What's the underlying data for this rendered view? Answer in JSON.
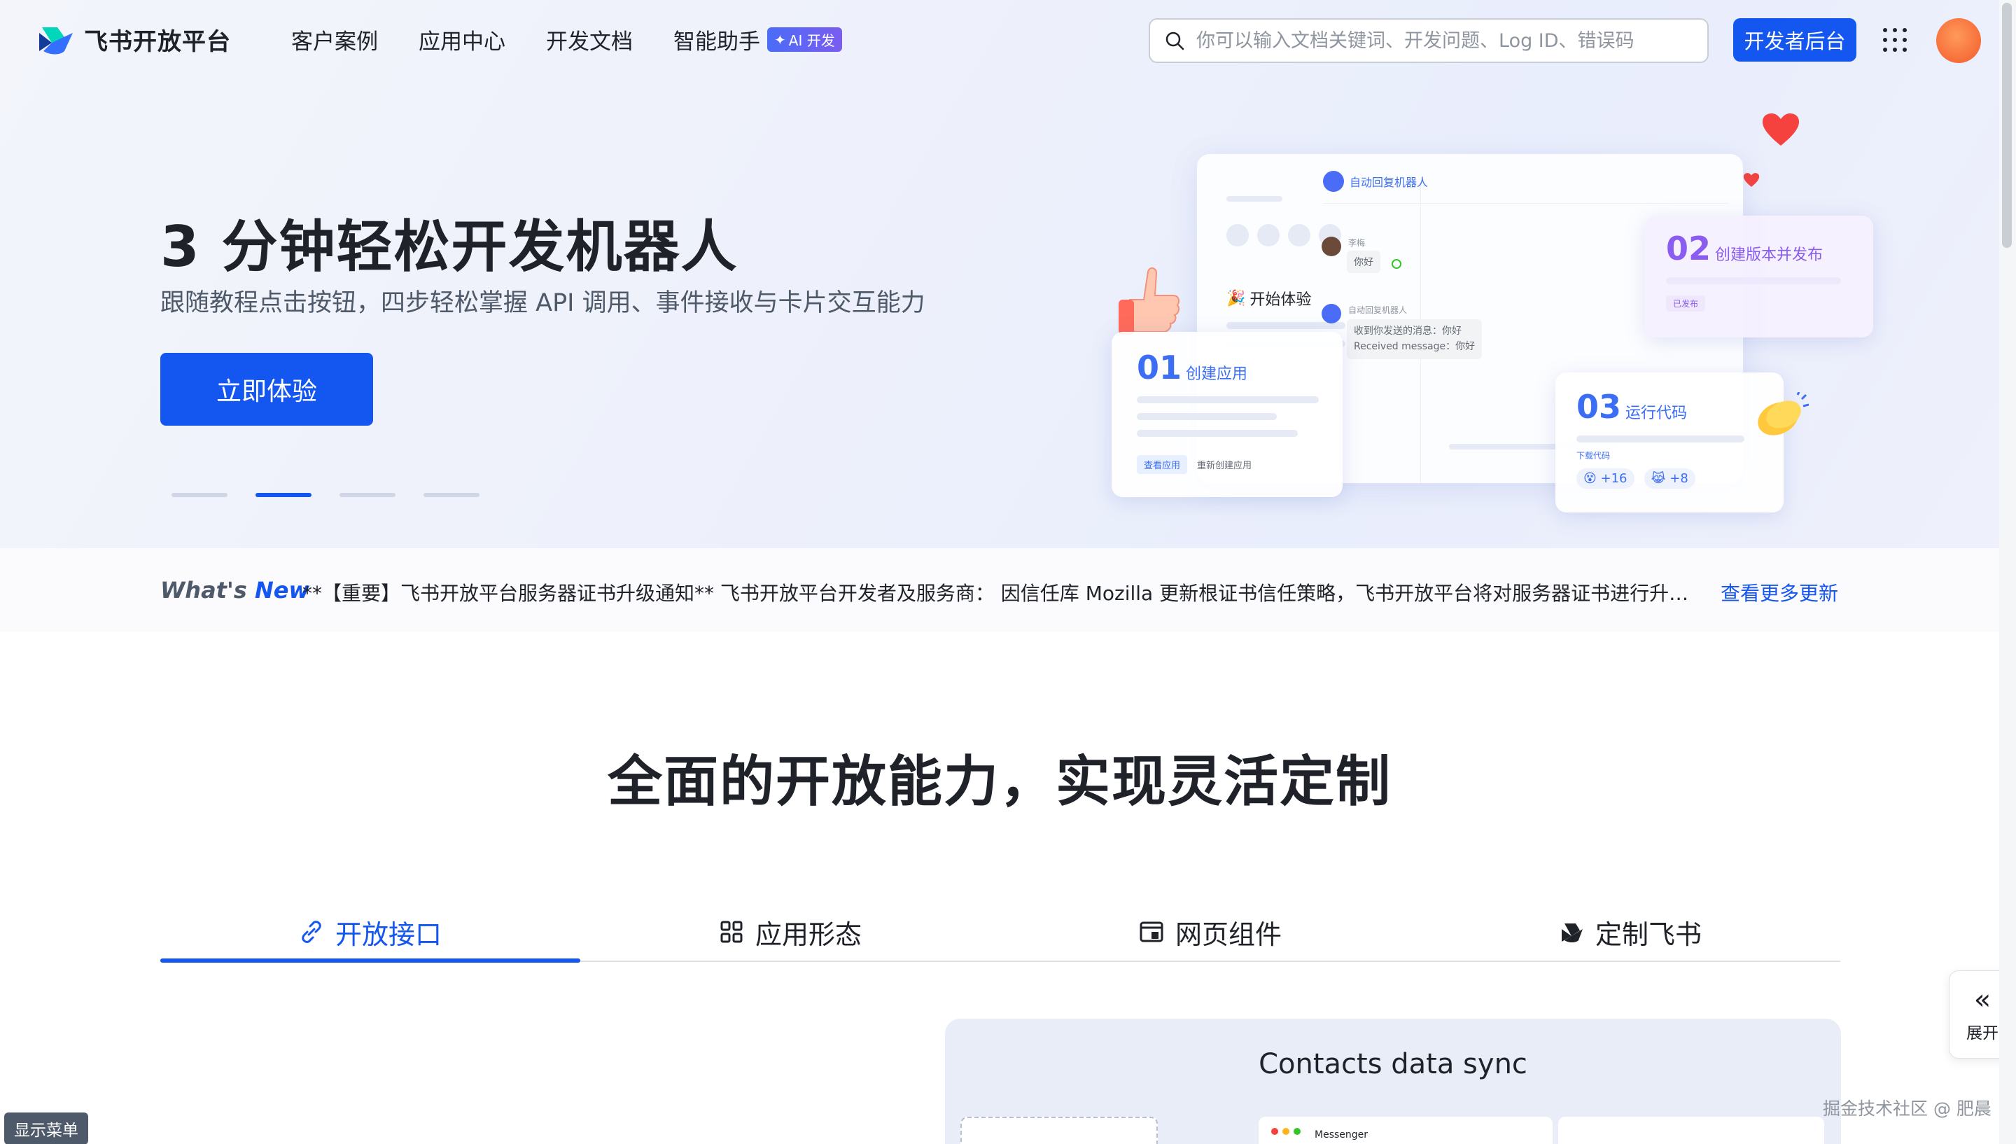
{
  "header": {
    "logo_text": "飞书开放平台",
    "nav": [
      "客户案例",
      "应用中心",
      "开发文档",
      "智能助手"
    ],
    "ai_badge": "AI 开发",
    "search_placeholder": "你可以输入文档关键词、开发问题、Log ID、错误码",
    "dev_button": "开发者后台"
  },
  "hero": {
    "title": "3 分钟轻松开发机器人",
    "subtitle": "跟随教程点击按钮，四步轻松掌握 API 调用、事件接收与卡片交互能力",
    "cta": "立即体验",
    "carousel_count": 4,
    "carousel_active": 2,
    "illustration": {
      "chat_title": "自动回复机器人",
      "start": "开始体验",
      "step1_num": "01",
      "step1_label": "创建应用",
      "step1_actions": [
        "查看应用",
        "重新创建应用"
      ],
      "step2_num": "02",
      "step2_label": "创建版本并发布",
      "step2_tag": "已发布",
      "step3_num": "03",
      "step3_label": "运行代码",
      "step3_sub": "下载代码",
      "reaction1": "+16",
      "reaction2": "+8",
      "user_name": "李梅",
      "msg_hello": "你好",
      "bot_name": "自动回复机器人",
      "bot_reply_1": "收到你发送的消息：你好",
      "bot_reply_2": "Received message：你好"
    }
  },
  "news": {
    "label_what": "What's",
    "label_new": "New",
    "text": "**【重要】飞书开放平台服务器证书升级通知** 飞书开放平台开发者及服务商：  因信任库 Mozilla 更新根证书信任策略，飞书开放平台将对服务器证书进行升级，请及时检查并更新证书信任配置。",
    "more": "查看更多更新"
  },
  "section": {
    "title": "全面的开放能力，实现灵活定制",
    "tabs": [
      "开放接口",
      "应用形态",
      "网页组件",
      "定制飞书"
    ],
    "active_tab": 0,
    "demo_title": "Contacts data sync",
    "demo_messenger": "Messenger"
  },
  "floating": {
    "expand": "展开",
    "show_menu": "显示菜单",
    "watermark": "掘金技术社区 @ 肥晨"
  },
  "colors": {
    "brand": "#1456f0",
    "text": "#1f2329",
    "subtext": "#4e5969"
  }
}
